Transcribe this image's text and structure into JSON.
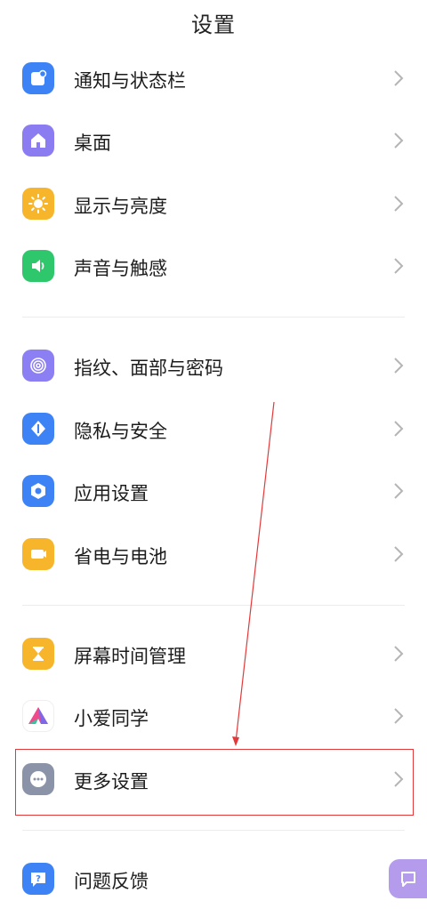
{
  "header": {
    "title": "设置"
  },
  "groups": [
    {
      "items": [
        {
          "label": "通知与状态栏",
          "icon": "notification-icon",
          "color": "#3d83f5"
        },
        {
          "label": "桌面",
          "icon": "home-icon",
          "color": "#8b7cf2"
        },
        {
          "label": "显示与亮度",
          "icon": "brightness-icon",
          "color": "#f7b52c"
        },
        {
          "label": "声音与触感",
          "icon": "speaker-icon",
          "color": "#2ec76c"
        }
      ]
    },
    {
      "items": [
        {
          "label": "指纹、面部与密码",
          "icon": "fingerprint-icon",
          "color": "#8c7ef3"
        },
        {
          "label": "隐私与安全",
          "icon": "privacy-icon",
          "color": "#3d83f5"
        },
        {
          "label": "应用设置",
          "icon": "app-settings-icon",
          "color": "#3d83f5"
        },
        {
          "label": "省电与电池",
          "icon": "battery-icon",
          "color": "#f7b52c"
        }
      ]
    },
    {
      "items": [
        {
          "label": "屏幕时间管理",
          "icon": "hourglass-icon",
          "color": "#f7b52c"
        },
        {
          "label": "小爱同学",
          "icon": "xiaoai-icon",
          "color": "#ffffff"
        },
        {
          "label": "更多设置",
          "icon": "more-icon",
          "color": "#8a93a8"
        }
      ]
    },
    {
      "items": [
        {
          "label": "问题反馈",
          "icon": "feedback-icon",
          "color": "#3d83f5"
        }
      ]
    }
  ],
  "annotation": {
    "highlight_color": "#e23a3a"
  },
  "floating": {
    "icon": "chat-icon",
    "color": "#b49bec"
  }
}
